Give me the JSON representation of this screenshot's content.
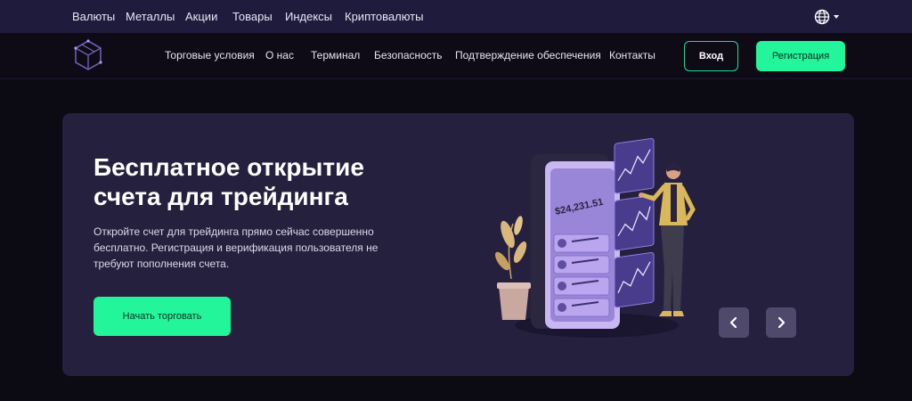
{
  "topbar": {
    "links": [
      "Валюты",
      "Металлы",
      "Акции",
      "Товары",
      "Индексы",
      "Криптовалюты"
    ],
    "lang_icon": "globe-icon"
  },
  "navbar": {
    "logo_icon": "cube-logo-icon",
    "links": [
      "Торговые условия",
      "О нас",
      "Терминал",
      "Безопасность",
      "Подтверждение обеспечения",
      "Контакты"
    ],
    "login_label": "Вход",
    "register_label": "Регистрация"
  },
  "hero": {
    "title": "Бесплатное открытие счета для трейдинга",
    "description": "Откройте счет для трейдинга прямо сейчас совершенно бесплатно. Регистрация и верификация пользователя не требуют пополнения счета.",
    "cta_label": "Начать торговать",
    "phone_balance": "$24,231.51",
    "prev_icon": "chevron-left-icon",
    "next_icon": "chevron-right-icon"
  },
  "colors": {
    "accent": "#22f59a",
    "topbar_bg": "#1f1b3d",
    "hero_bg": "#26203f",
    "page_bg": "#0c0a12"
  }
}
